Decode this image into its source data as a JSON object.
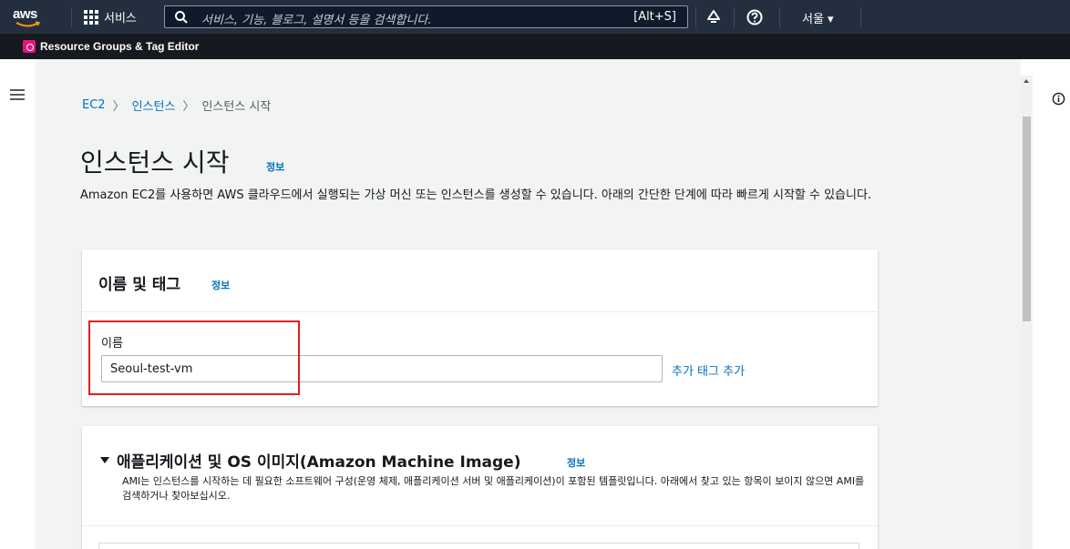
{
  "topnav": {
    "logo_text": "aws",
    "services_label": "서비스",
    "search_placeholder": "서비스, 기능, 블로그, 설명서 등을 검색합니다.",
    "search_shortcut": "[Alt+S]",
    "region_label": "서울 ▾",
    "icons": [
      "grid-icon",
      "search-icon",
      "bell-icon",
      "help-icon"
    ]
  },
  "favorites": {
    "item_label": "Resource Groups & Tag Editor"
  },
  "breadcrumb": {
    "items": [
      "EC2",
      "인스턴스",
      "인스턴스 시작"
    ]
  },
  "page": {
    "title": "인스턴스 시작",
    "info": "정보",
    "description": "Amazon EC2를 사용하면 AWS 클라우드에서 실행되는 가상 머신 또는 인스턴스를 생성할 수 있습니다. 아래의 간단한 단계에 따라 빠르게 시작할 수 있습니다."
  },
  "name_tags": {
    "title": "이름 및 태그",
    "info": "정보",
    "field_label": "이름",
    "name_value": "Seoul-test-vm",
    "add_tag_link": "추가 태그 추가"
  },
  "ami": {
    "title": "애플리케이션 및 OS 이미지(Amazon Machine Image)",
    "info": "정보",
    "description": "AMI는 인스턴스를 시작하는 데 필요한 소프트웨어 구성(운영 체제, 애플리케이션 서버 및 애플리케이션)이 포함된 템플릿입니다. 아래에서 찾고 있는 항목이 보이지 않으면 AMI를 검색하거나 찾아보십시오."
  },
  "colors": {
    "nav_bg": "#232f3e",
    "fav_bg": "#16191f",
    "link": "#0073bb",
    "highlight": "#e11d1d"
  }
}
